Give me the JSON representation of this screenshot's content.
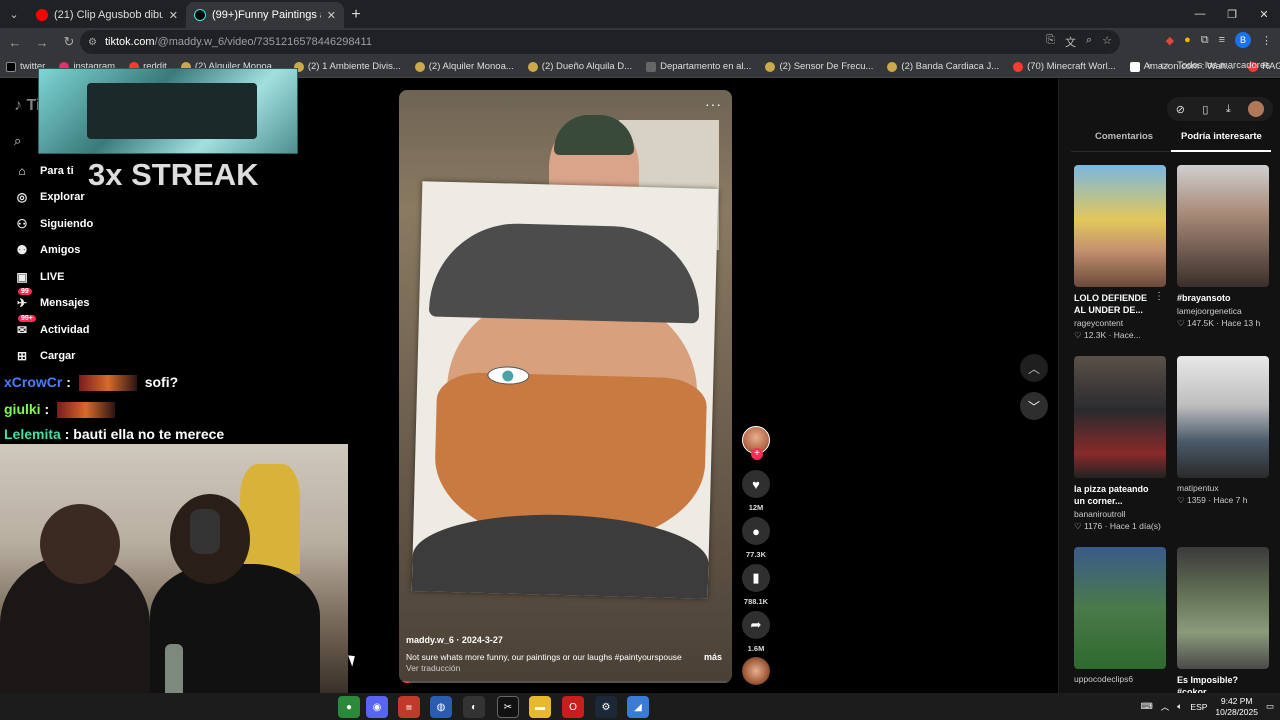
{
  "browser": {
    "tabs": [
      {
        "title": "(21) Clip Agusbob dibujo - YouT",
        "active": false
      },
      {
        "title": "(99+)Funny Paintings and Laug",
        "active": true
      }
    ],
    "url_host": "tiktok.com",
    "url_path": "/@maddy.w_6/video/7351216578446298411",
    "bookmarks": [
      "twitter",
      "instagram",
      "reddit",
      "(2) Alquiler Monoa...",
      "(2) 1 Ambiente Divis...",
      "(2) Alquiler Monoa...",
      "(2) Dueño Alquila D...",
      "Departamento en al...",
      "(2) Sensor De Frecu...",
      "(2) Banda Cardiaca J...",
      "(70) Minecraft Worl...",
      "Amazon.com : Wah...",
      "RAG"
    ],
    "all_bookmarks": "Todos los marcadores",
    "profile_initial": "B"
  },
  "tiktok": {
    "logo": "TikTok",
    "nav": [
      {
        "label": "Para ti",
        "icon": "home-icon",
        "glyph": "⌂"
      },
      {
        "label": "Explorar",
        "icon": "compass-icon",
        "glyph": "◎"
      },
      {
        "label": "Siguiendo",
        "icon": "following-icon",
        "glyph": "⚇"
      },
      {
        "label": "Amigos",
        "icon": "friends-icon",
        "glyph": "⚉"
      },
      {
        "label": "LIVE",
        "icon": "live-icon",
        "glyph": "▣"
      },
      {
        "label": "Mensajes",
        "icon": "messages-icon",
        "glyph": "✈",
        "badge": "99"
      },
      {
        "label": "Actividad",
        "icon": "activity-icon",
        "glyph": "✉",
        "badge": "99+"
      },
      {
        "label": "Cargar",
        "icon": "upload-icon",
        "glyph": "⊞"
      }
    ],
    "video": {
      "author": "maddy.w_6 · 2024-3-27",
      "description": "Not sure whats more funny, our paintings or our laughs  #paintyourspouse",
      "more": "más",
      "translate": "Ver traducción",
      "progress": 0.03
    },
    "actions": {
      "likes": "12M",
      "comments": "77.3K",
      "saves": "788.1K",
      "shares": "1.6M"
    },
    "panel": {
      "tabs": [
        "Comentarios",
        "Podría interesarte"
      ],
      "cards": [
        {
          "title": "LOLO DEFIENDE\nAL UNDER DE...",
          "user": "rageycontent",
          "meta": "♡ 12.3K · Hace..."
        },
        {
          "title": "#brayansoto",
          "user": "lamejoorgenetica",
          "meta": "♡ 147.5K · Hace 13 h"
        },
        {
          "title": "la pizza pateando\nun corner...",
          "user": "bananiroutroll",
          "meta": "♡ 1176 · Hace 1 día(s)"
        },
        {
          "title": "",
          "user": "matipentux",
          "meta": "♡ 1359 · Hace 7 h"
        },
        {
          "title": "",
          "user": "uppocodeclips6",
          "meta": ""
        },
        {
          "title": "Es Imposible?\n#cokor",
          "user": "",
          "meta": ""
        }
      ]
    }
  },
  "stream": {
    "streak": "3x STREAK",
    "chat": [
      {
        "user": "xCrowCr",
        "msg": "sofi?"
      },
      {
        "user": "giulki",
        "msg": ""
      },
      {
        "user": "Lelemita",
        "msg": "bauti ella no te merece"
      }
    ]
  },
  "taskbar": {
    "lang": "ESP",
    "time": "9:42 PM",
    "date": "10/28/2025"
  }
}
